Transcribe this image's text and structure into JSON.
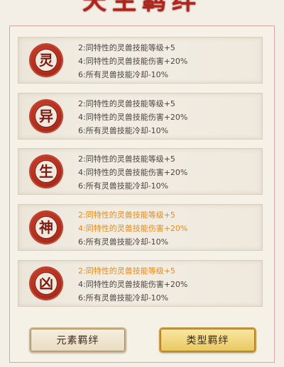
{
  "header": {
    "title": "天生羁绊"
  },
  "cards": [
    {
      "glyph": "灵",
      "lines": [
        "2:同特性的灵兽技能等级+5",
        "4:同特性的灵兽技能伤害+20%",
        "6:所有灵兽技能冷却-10%"
      ],
      "highlighted": [
        false,
        false,
        false
      ]
    },
    {
      "glyph": "异",
      "lines": [
        "2:同特性的灵兽技能等级+5",
        "4:同特性的灵兽技能伤害+20%",
        "6:所有灵兽技能冷却-10%"
      ],
      "highlighted": [
        false,
        false,
        false
      ]
    },
    {
      "glyph": "生",
      "lines": [
        "2:同特性的灵兽技能等级+5",
        "4:同特性的灵兽技能伤害+20%",
        "6:所有灵兽技能冷却-10%"
      ],
      "highlighted": [
        false,
        false,
        false
      ]
    },
    {
      "glyph": "神",
      "lines": [
        "2:同特性的灵兽技能等级+5",
        "4:同特性的灵兽技能伤害+20%",
        "6:所有灵兽技能冷却-10%"
      ],
      "highlighted": [
        true,
        true,
        false
      ]
    },
    {
      "glyph": "凶",
      "lines": [
        "2:同特性的灵兽技能等级+5",
        "4:同特性的灵兽技能伤害+20%",
        "6:所有灵兽技能冷却-10%"
      ],
      "highlighted": [
        true,
        false,
        false
      ]
    }
  ],
  "buttons": {
    "element_bond": "元素羁绊",
    "type_bond": "类型羁绊"
  },
  "colors": {
    "seal_red": "#b6301f",
    "highlight_orange": "#e68a1c",
    "text_gray": "#4a4440",
    "button_gold": "#e9c861"
  }
}
